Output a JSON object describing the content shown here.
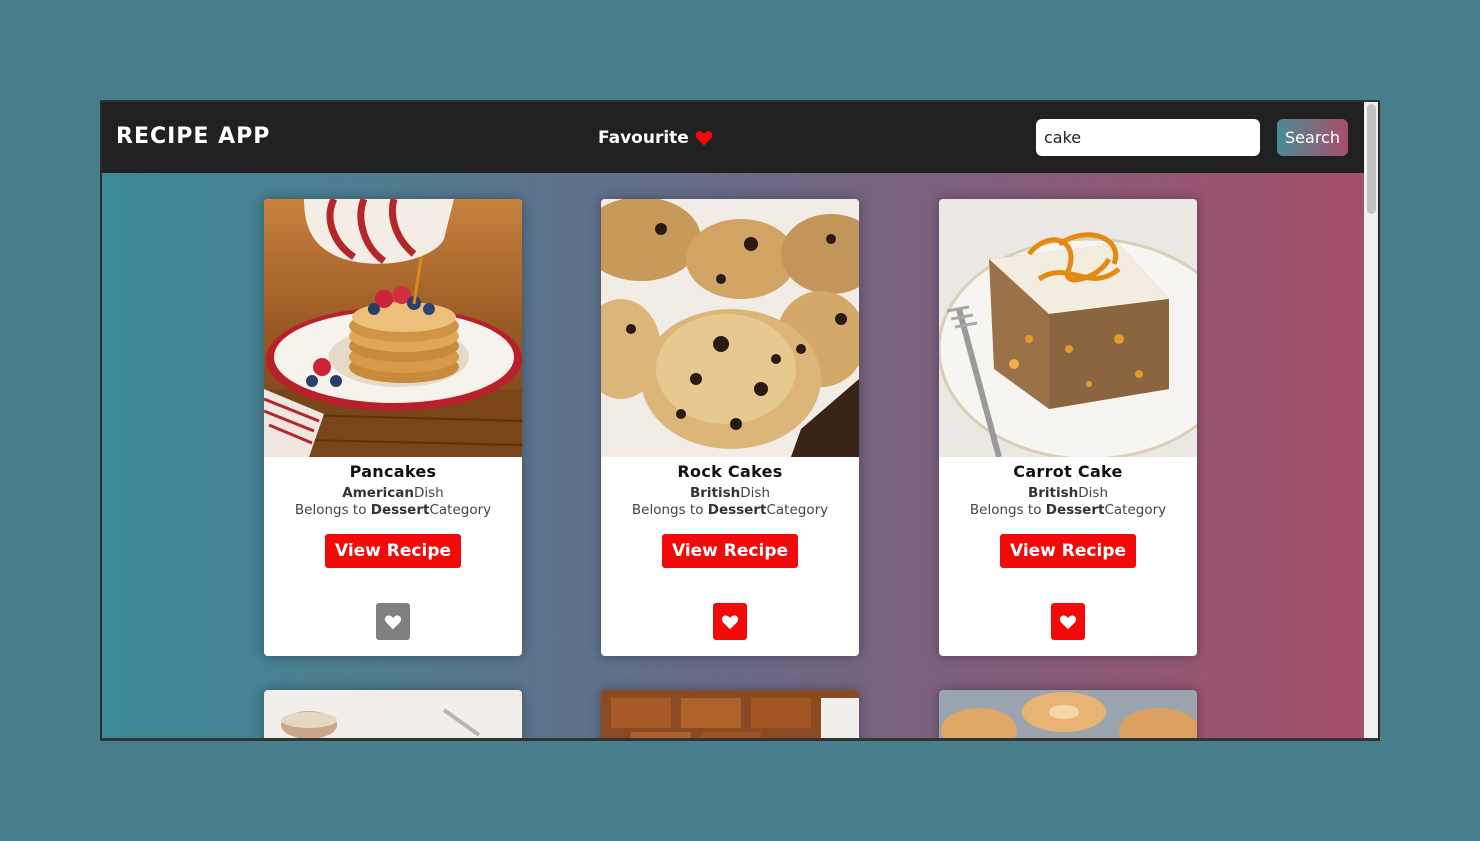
{
  "navbar": {
    "title": "RECIPE APP",
    "favourite_label": "Favourite",
    "search_value": "cake",
    "search_button": "Search"
  },
  "colors": {
    "accent_red": "#f20a0a",
    "navbar_bg": "#212121",
    "gradient_start": "#3b8a97",
    "gradient_end": "#a84e6a"
  },
  "cards": [
    {
      "name": "Pancakes",
      "area": "American",
      "area_suffix": "Dish",
      "belongs_prefix": "Belongs to ",
      "category": "Dessert",
      "category_suffix": "Category",
      "button": "View Recipe",
      "favourited": false
    },
    {
      "name": "Rock Cakes",
      "area": "British",
      "area_suffix": "Dish",
      "belongs_prefix": "Belongs to ",
      "category": "Dessert",
      "category_suffix": "Category",
      "button": "View Recipe",
      "favourited": true
    },
    {
      "name": "Carrot Cake",
      "area": "British",
      "area_suffix": "Dish",
      "belongs_prefix": "Belongs to ",
      "category": "Dessert",
      "category_suffix": "Category",
      "button": "View Recipe",
      "favourited": true
    }
  ]
}
